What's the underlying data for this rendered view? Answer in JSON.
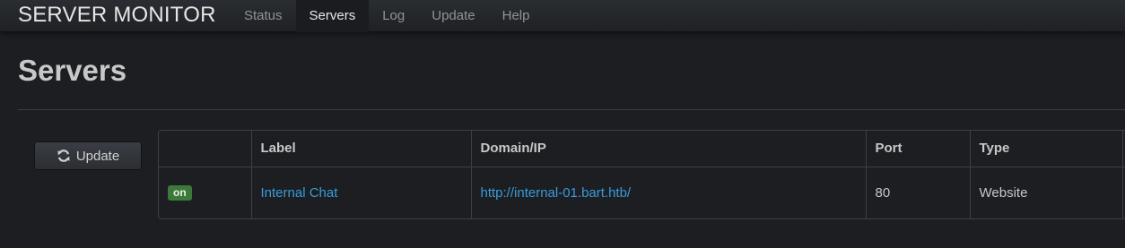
{
  "app": {
    "brand": "SERVER MONITOR",
    "nav": [
      {
        "label": "Status",
        "active": false
      },
      {
        "label": "Servers",
        "active": true
      },
      {
        "label": "Log",
        "active": false
      },
      {
        "label": "Update",
        "active": false
      },
      {
        "label": "Help",
        "active": false
      }
    ]
  },
  "page": {
    "title": "Servers",
    "update_button": {
      "label": "Update",
      "icon": "refresh-icon"
    }
  },
  "table": {
    "headers": [
      "",
      "Label",
      "Domain/IP",
      "Port",
      "Type"
    ],
    "rows": [
      {
        "status": "on",
        "label": "Internal Chat",
        "domain": "http://internal-01.bart.htb/",
        "port": "80",
        "type": "Website"
      }
    ]
  },
  "colors": {
    "background": "#1c1e22",
    "link": "#3a9bd9",
    "status_on": "#3d7a3a"
  }
}
